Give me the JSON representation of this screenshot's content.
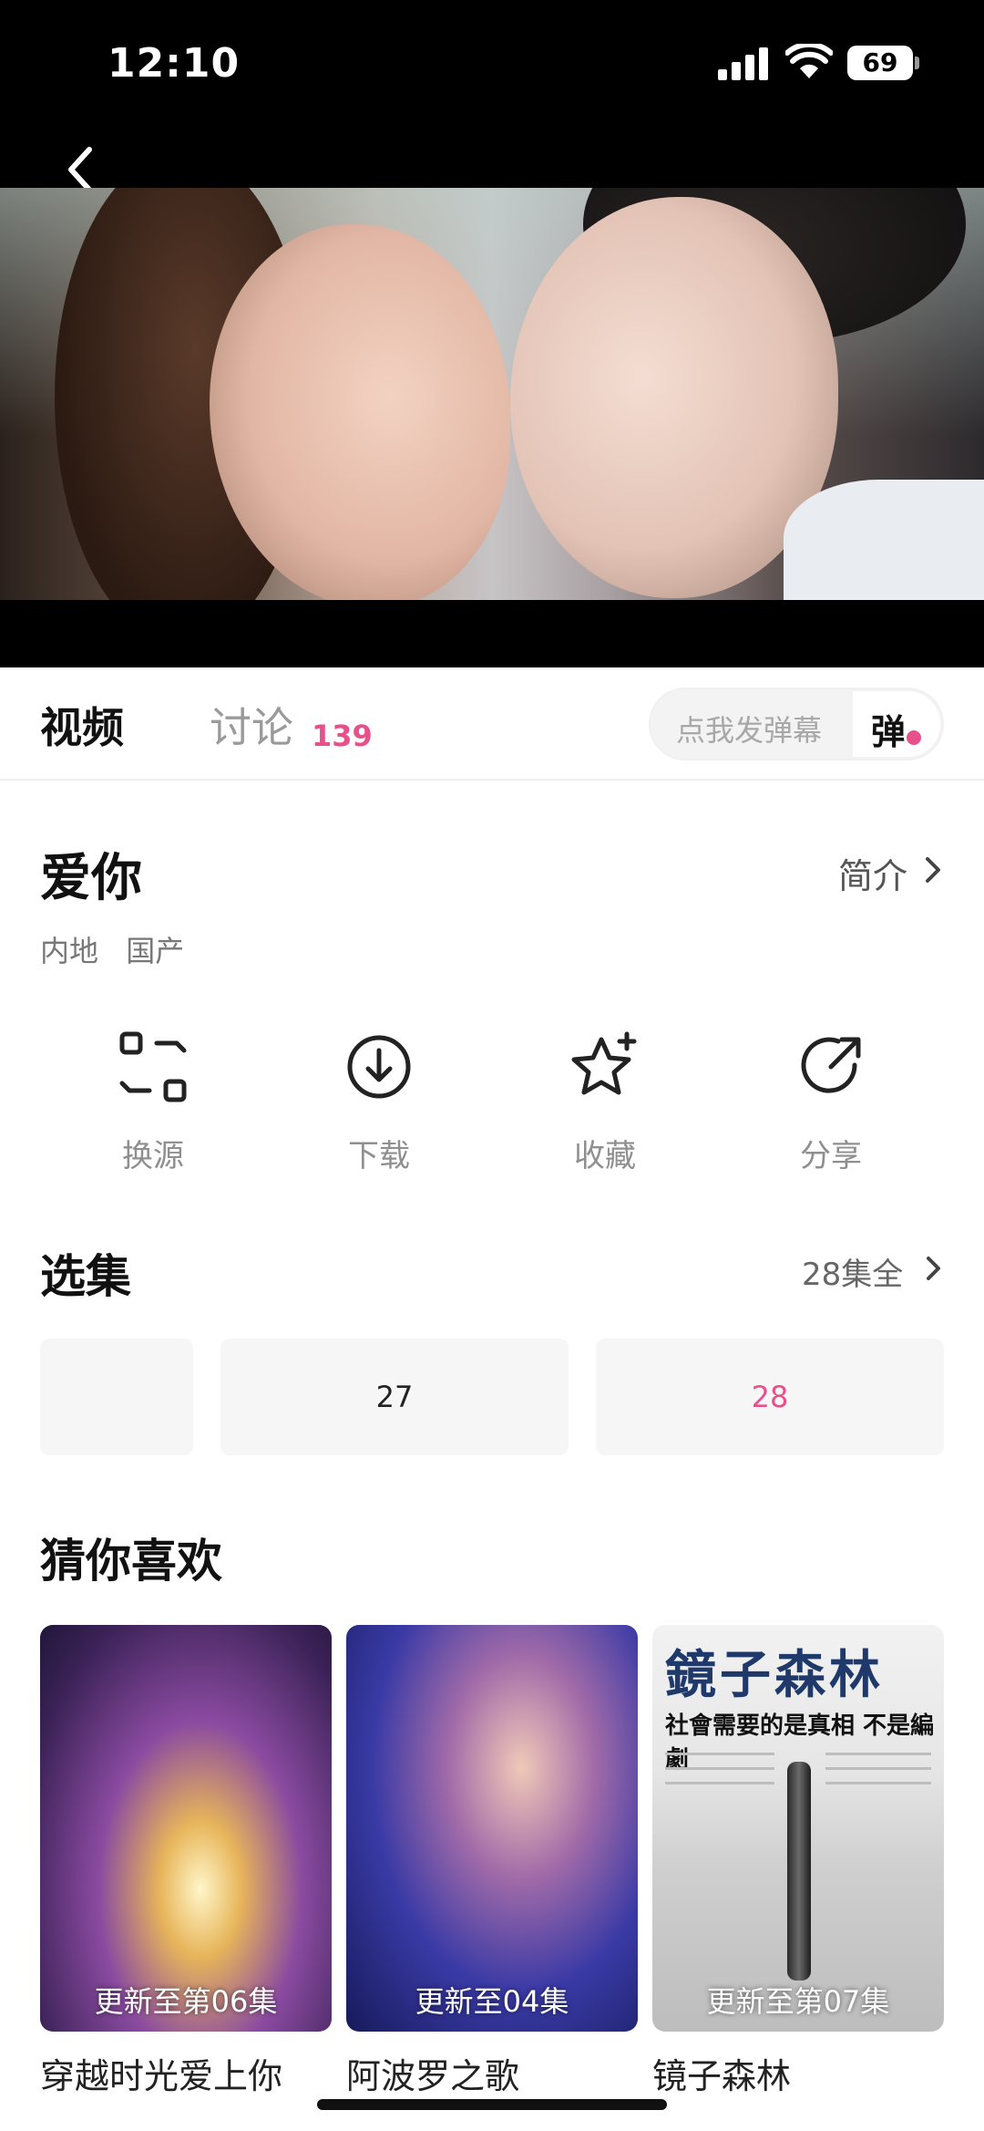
{
  "status_bar": {
    "time": "12:10",
    "battery": "69"
  },
  "tabs": {
    "video": "视频",
    "discussion": "讨论",
    "discussion_count": "139"
  },
  "danmaku": {
    "placeholder": "点我发弹幕",
    "button": "弹"
  },
  "show": {
    "title": "爱你",
    "intro": "简介",
    "tags": [
      "内地",
      "国产"
    ]
  },
  "actions": [
    {
      "label": "换源",
      "icon": "switch-source-icon"
    },
    {
      "label": "下载",
      "icon": "download-icon"
    },
    {
      "label": "收藏",
      "icon": "favorite-star-icon"
    },
    {
      "label": "分享",
      "icon": "share-icon"
    }
  ],
  "episodes": {
    "title": "选集",
    "count": "28集全",
    "items": [
      "",
      "27",
      "28"
    ],
    "active": "28"
  },
  "recommend": {
    "title": "猜你喜欢",
    "items": [
      {
        "name": "穿越时光爱上你",
        "badge": "更新至第06集"
      },
      {
        "name": "阿波罗之歌",
        "badge": "更新至04集"
      },
      {
        "name": "镜子森林",
        "badge": "更新至第07集",
        "poster_title": "鏡子森林",
        "poster_headline": "社會需要的是真相 不是編劇"
      }
    ]
  },
  "colors": {
    "accent": "#e8508c"
  }
}
